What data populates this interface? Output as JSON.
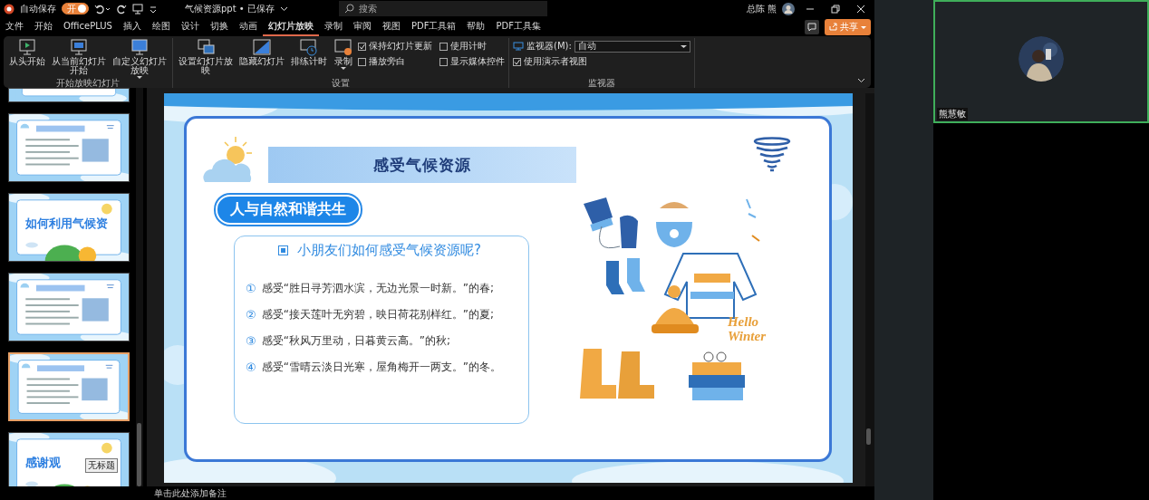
{
  "title_bar": {
    "autosave_label": "自动保存",
    "autosave": {
      "label": "开",
      "on": true
    },
    "document_title": "气候资源ppt • 已保存",
    "search": {
      "placeholder": "搜索"
    },
    "user_name": "总陈 熊"
  },
  "menu_tabs": [
    {
      "label": "文件",
      "selected": false
    },
    {
      "label": "开始",
      "selected": false
    },
    {
      "label": "OfficePLUS",
      "selected": false
    },
    {
      "label": "插入",
      "selected": false
    },
    {
      "label": "绘图",
      "selected": false
    },
    {
      "label": "设计",
      "selected": false
    },
    {
      "label": "切换",
      "selected": false
    },
    {
      "label": "动画",
      "selected": false
    },
    {
      "label": "幻灯片放映",
      "selected": true
    },
    {
      "label": "录制",
      "selected": false
    },
    {
      "label": "审阅",
      "selected": false
    },
    {
      "label": "视图",
      "selected": false
    },
    {
      "label": "PDF工具箱",
      "selected": false
    },
    {
      "label": "帮助",
      "selected": false
    },
    {
      "label": "PDF工具集",
      "selected": false
    }
  ],
  "share_button": "共享",
  "ribbon": {
    "groups": [
      {
        "label": "开始放映幻灯片",
        "controls": [
          {
            "kind": "big",
            "label": "从头开始"
          },
          {
            "kind": "big",
            "label": "从当前幻灯片开始"
          },
          {
            "kind": "big",
            "label": "自定义幻灯片放映",
            "dropdown": true
          }
        ]
      },
      {
        "label": "设置",
        "controls": [
          {
            "kind": "big",
            "label": "设置幻灯片放映"
          },
          {
            "kind": "big",
            "label": "隐藏幻灯片"
          },
          {
            "kind": "big",
            "label": "排练计时"
          },
          {
            "kind": "big",
            "label": "录制",
            "dropdown": true
          },
          {
            "kind": "check",
            "label": "保持幻灯片更新",
            "checked": true
          },
          {
            "kind": "check",
            "label": "播放旁白",
            "checked": false
          },
          {
            "kind": "check",
            "label": "使用计时",
            "checked": false
          },
          {
            "kind": "check",
            "label": "显示媒体控件",
            "checked": false
          }
        ]
      },
      {
        "label": "监视器",
        "controls": [
          {
            "kind": "select",
            "label": "监视器(M):",
            "value": "自动"
          },
          {
            "kind": "check",
            "label": "使用演示者视图",
            "checked": true
          }
        ]
      }
    ]
  },
  "thumbnails": [
    {
      "kind": "cut",
      "selected": false
    },
    {
      "kind": "content",
      "selected": false
    },
    {
      "kind": "title",
      "title": "如何利用气候资",
      "selected": false
    },
    {
      "kind": "content",
      "selected": false
    },
    {
      "kind": "content",
      "selected": true
    },
    {
      "kind": "title",
      "title": "感谢观",
      "selected": false,
      "tooltip": "无标题"
    }
  ],
  "slide": {
    "title": "感受气候资源",
    "pill": "人与自然和谐共生",
    "question": "小朋友们如何感受气候资源呢?",
    "lines": [
      {
        "number": "①",
        "text": "感受“胜日寻芳泗水滨，无边光景一时新。”的春;"
      },
      {
        "number": "②",
        "text": "感受“接天莲叶无穷碧，映日荷花别样红。”的夏;"
      },
      {
        "number": "③",
        "text": "感受“秋风万里动，日暮黄云高。”的秋;"
      },
      {
        "number": "④",
        "text": "感受“雪晴云淡日光寒，屋角梅开一两支。”的冬。"
      }
    ],
    "illustration_caption": [
      "Hello",
      "Winter"
    ]
  },
  "notes_placeholder": "单击此处添加备注",
  "video_tile": {
    "participant_name": "熊慧敏"
  }
}
